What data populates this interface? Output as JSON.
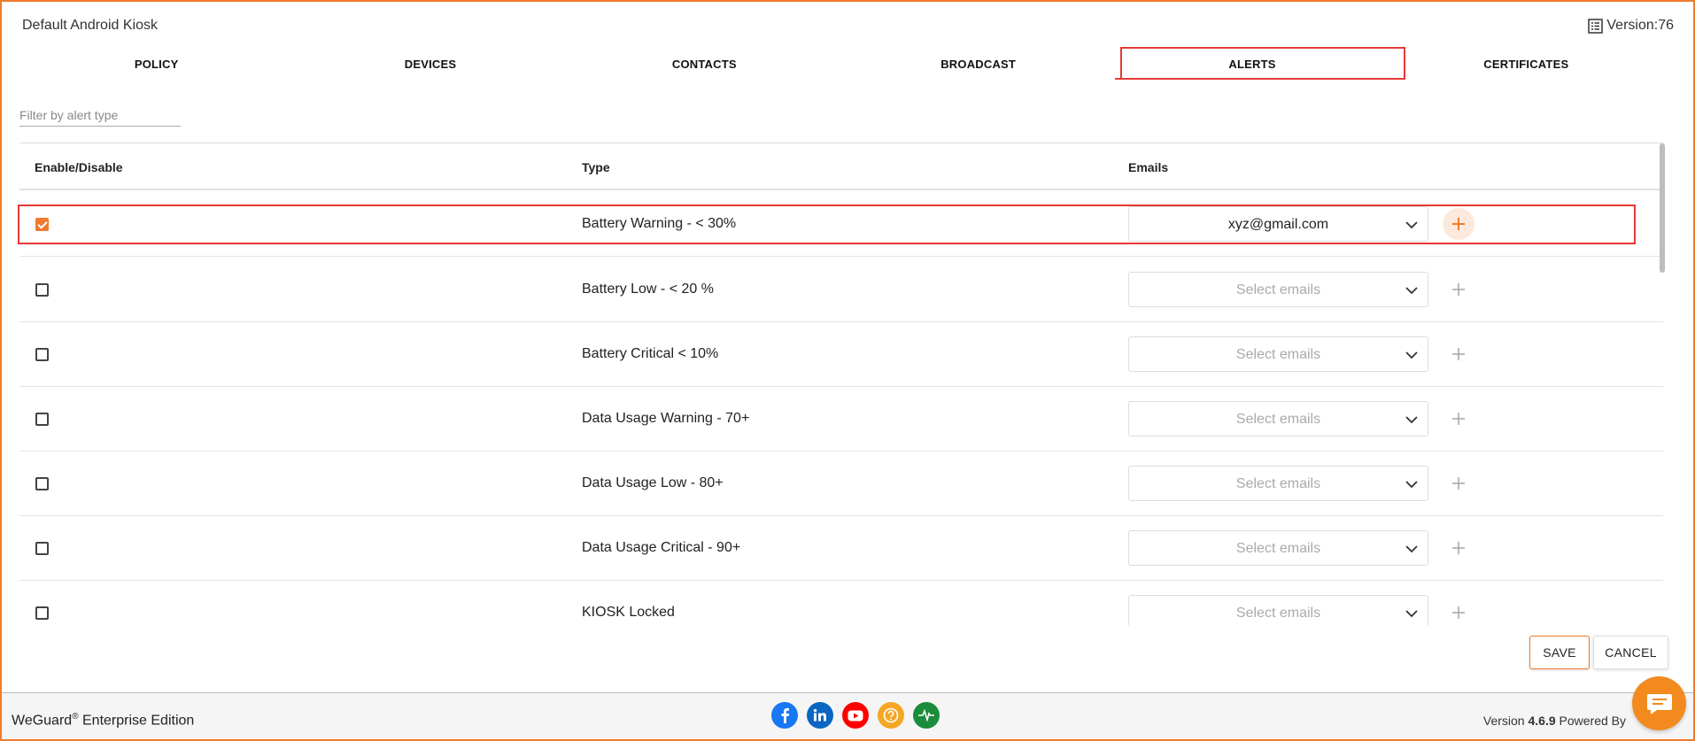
{
  "header": {
    "app_title": "Default Android Kiosk",
    "version_label": "Version:76"
  },
  "tabs": [
    {
      "label": "POLICY",
      "active": false
    },
    {
      "label": "DEVICES",
      "active": false
    },
    {
      "label": "CONTACTS",
      "active": false
    },
    {
      "label": "BROADCAST",
      "active": false
    },
    {
      "label": "ALERTS",
      "active": true
    },
    {
      "label": "CERTIFICATES",
      "active": false
    }
  ],
  "filter": {
    "placeholder": "Filter by alert type",
    "value": ""
  },
  "table": {
    "columns": [
      "Enable/Disable",
      "Type",
      "Emails"
    ],
    "rows": [
      {
        "enabled": true,
        "type": "Battery Warning - < 30%",
        "emails": "xyz@gmail.com"
      },
      {
        "enabled": false,
        "type": "Battery Low - < 20 %",
        "emails": "Select emails"
      },
      {
        "enabled": false,
        "type": "Battery Critical < 10%",
        "emails": "Select emails"
      },
      {
        "enabled": false,
        "type": "Data Usage Warning - 70+",
        "emails": "Select emails"
      },
      {
        "enabled": false,
        "type": "Data Usage Low - 80+",
        "emails": "Select emails"
      },
      {
        "enabled": false,
        "type": "Data Usage Critical - 90+",
        "emails": "Select emails"
      },
      {
        "enabled": false,
        "type": "KIOSK Locked",
        "emails": "Select emails"
      }
    ]
  },
  "actions": {
    "save_label": "SAVE",
    "cancel_label": "CANCEL"
  },
  "footer": {
    "brand_name": "WeGuard",
    "brand_mark": "®",
    "brand_edition": " Enterprise Edition",
    "version_prefix": "Version ",
    "version_number": "4.6.9",
    "powered_by": "  Powered By ",
    "socials": [
      "facebook-icon",
      "linkedin-icon",
      "youtube-icon",
      "help-icon",
      "heartbeat-icon"
    ]
  },
  "colors": {
    "accent": "#f07a2e",
    "highlight": "#e53935",
    "facebook": "#1877f2",
    "linkedin": "#0a66c2",
    "youtube": "#ff0000",
    "help": "#f5a623",
    "status": "#1a8c3c",
    "chat": "#f28a1e"
  }
}
